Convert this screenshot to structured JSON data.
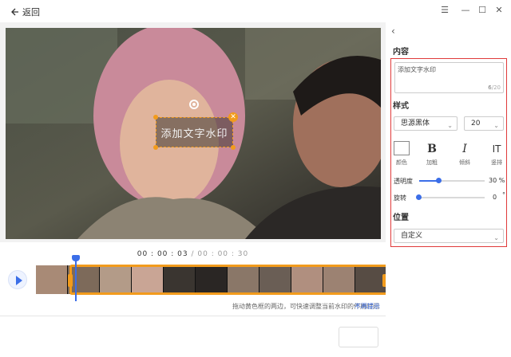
{
  "header": {
    "back_label": "返回"
  },
  "watermark": {
    "text": "添加文字水印"
  },
  "timeline": {
    "current": "00 : 00 : 03",
    "separator": " / ",
    "total": "00 : 00 : 30",
    "hint": "拖动黄色框的两边，可快速调整当前水印的作用时间",
    "hint_link": "不再提示"
  },
  "panel": {
    "content_label": "内容",
    "text_value": "添加文字水印",
    "char_count": "6",
    "char_max": "/20",
    "style_label": "样式",
    "font": "思源黑体",
    "font_size": "20",
    "color_label": "颜色",
    "bold_glyph": "B",
    "bold_label": "加粗",
    "italic_glyph": "I",
    "italic_label": "倾斜",
    "vertical_glyph": "IT",
    "vertical_label": "竖排",
    "opacity_label": "透明度",
    "opacity_value": "30 %",
    "opacity_fraction": 0.3,
    "rotate_label": "旋转",
    "rotate_value": "0",
    "rotate_unit": "°",
    "position_label": "位置",
    "position_value": "自定义"
  },
  "colors": {
    "accent": "#3b6ee8",
    "selection": "#f29b1c",
    "highlight": "#e03a3a"
  }
}
